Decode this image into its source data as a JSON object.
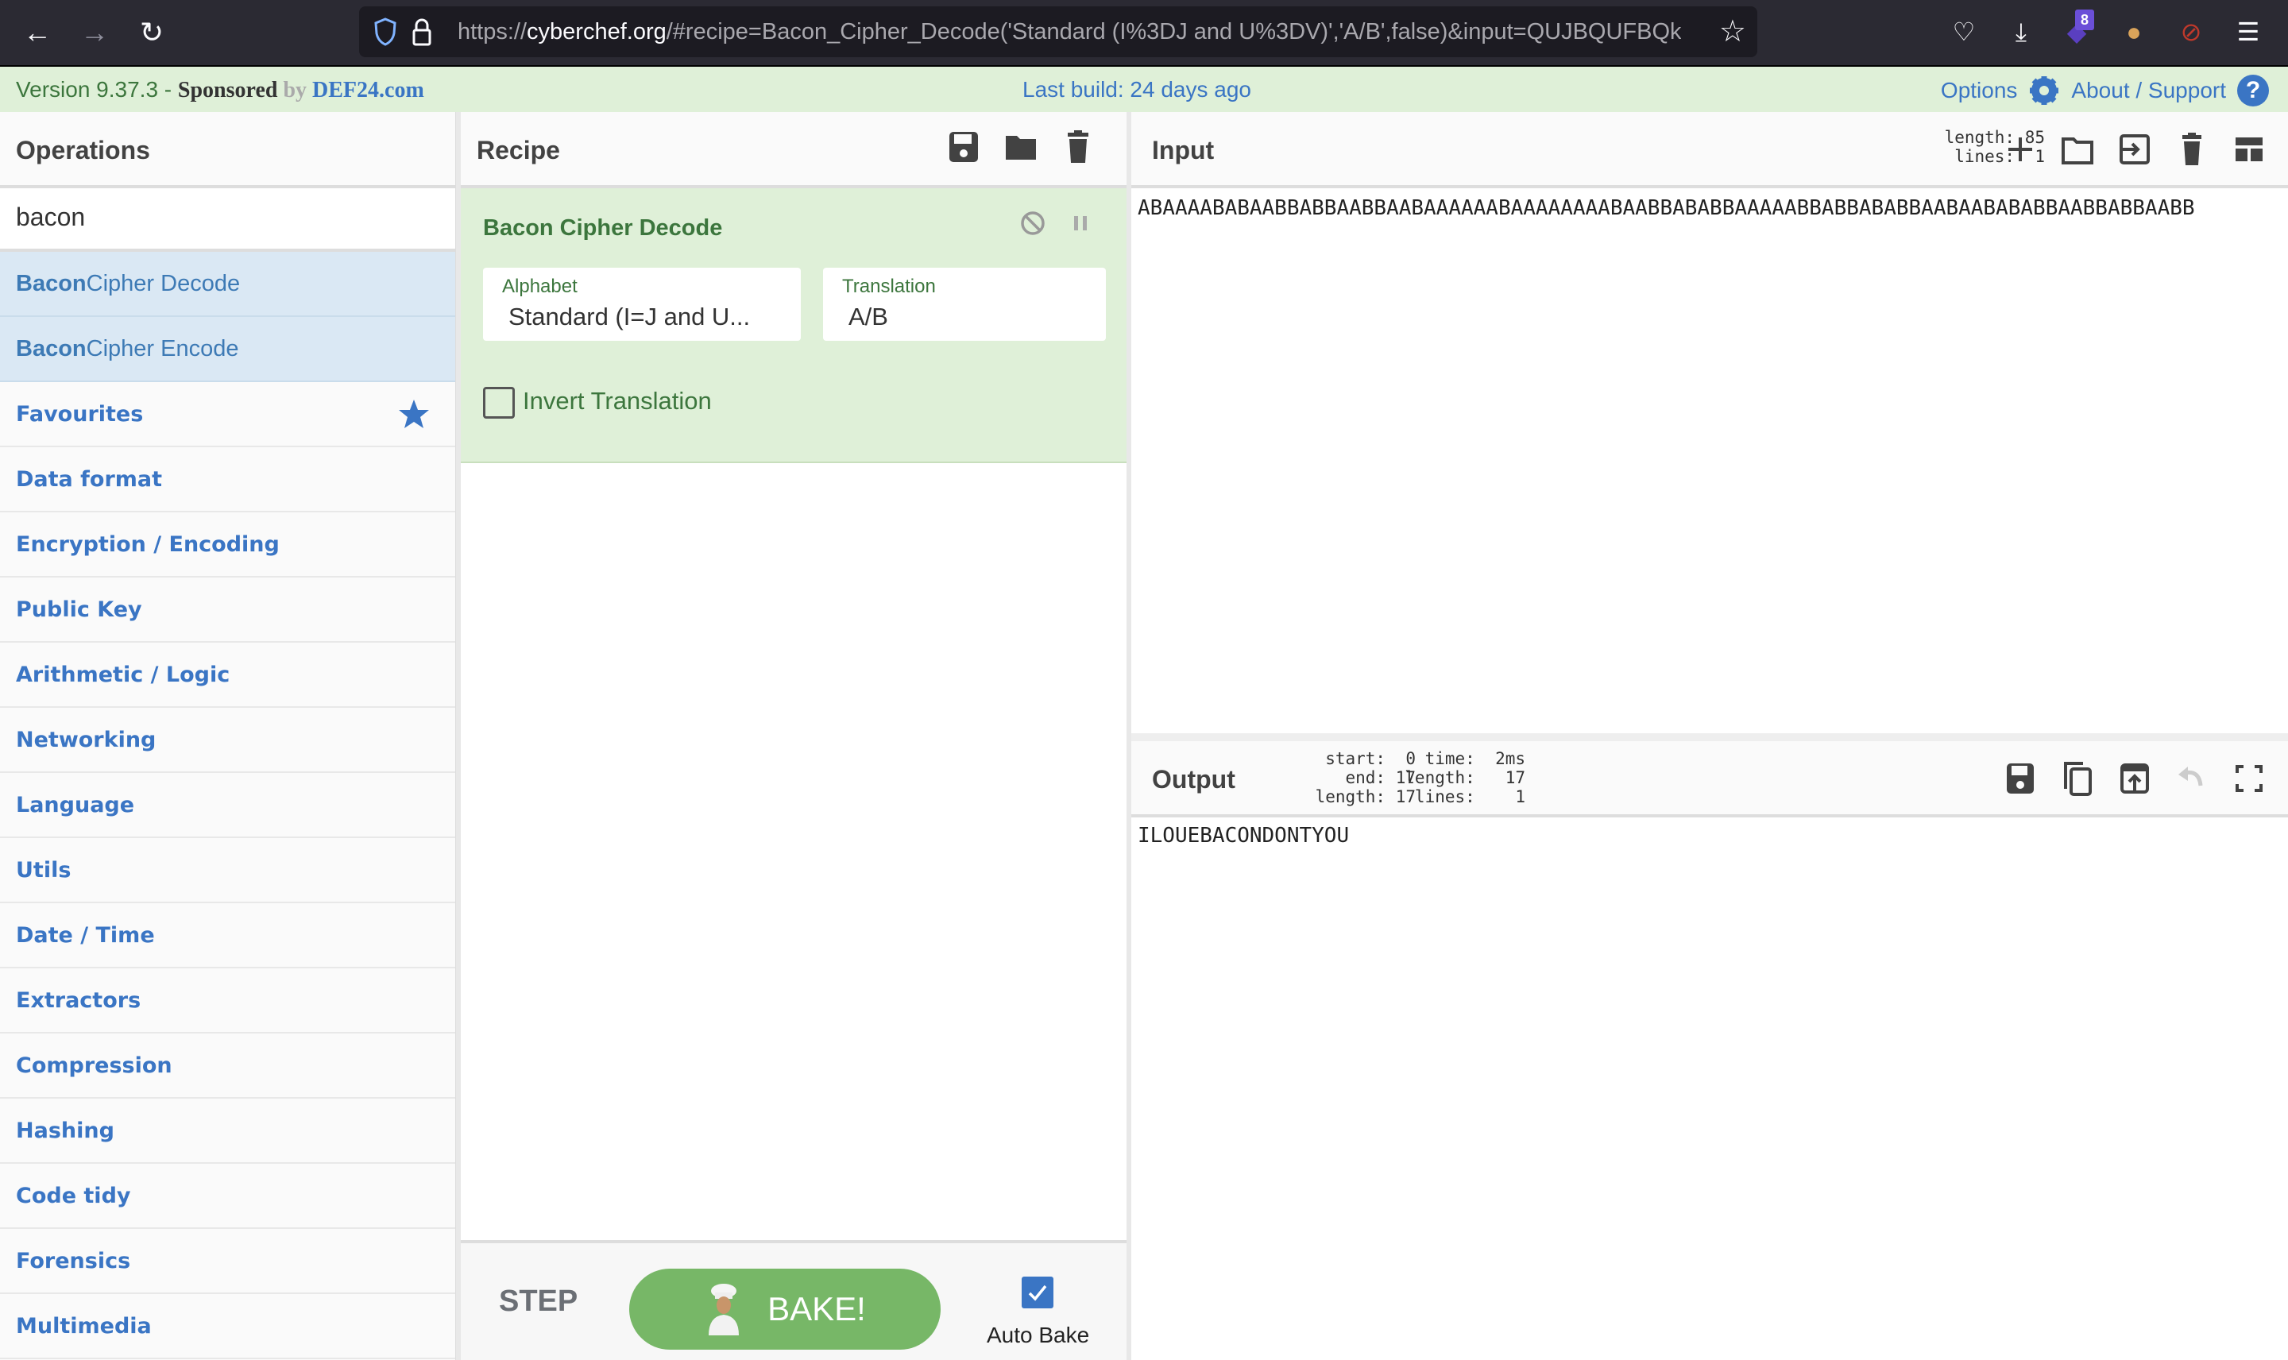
{
  "browser": {
    "url_prefix": "https://",
    "url_host": "cyberchef.org",
    "url_rest": "/#recipe=Bacon_Cipher_Decode('Standard (I%3DJ and U%3DV)','A/B',false)&input=QUJBQUFBQkFC",
    "extension_badge": "8"
  },
  "banner": {
    "version": "Version 9.37.3 - ",
    "sponsored": "Sponsored",
    "by": " by ",
    "sponsor": "DEF24.com",
    "last_build": "Last build: 24 days ago",
    "options": "Options",
    "about": "About / Support",
    "help_glyph": "?"
  },
  "operations": {
    "title": "Operations",
    "search_value": "bacon",
    "results": [
      {
        "match": "Bacon",
        "rest": " Cipher Decode"
      },
      {
        "match": "Bacon",
        "rest": " Cipher Encode"
      }
    ],
    "categories": [
      "Favourites",
      "Data format",
      "Encryption / Encoding",
      "Public Key",
      "Arithmetic / Logic",
      "Networking",
      "Language",
      "Utils",
      "Date / Time",
      "Extractors",
      "Compression",
      "Hashing",
      "Code tidy",
      "Forensics",
      "Multimedia"
    ]
  },
  "recipe": {
    "title": "Recipe",
    "operation": {
      "name": "Bacon Cipher Decode",
      "args": [
        {
          "label": "Alphabet",
          "value": "Standard (I=J and U..."
        },
        {
          "label": "Translation",
          "value": "A/B"
        }
      ],
      "invert_label": "Invert Translation",
      "invert_checked": false
    },
    "step_label": "STEP",
    "bake_label": "BAKE!",
    "auto_bake_label": "Auto Bake",
    "auto_bake_checked": true
  },
  "input": {
    "title": "Input",
    "stats": "length: 85\n lines:  1",
    "text": "ABAAAABABAABBABBAABBAABAAAAAABAAAAAAAABAABBABABBAAAAABBABBABABBAABAABABABBAABBABBAABB"
  },
  "output": {
    "title": "Output",
    "stats_left": " start:  0\n   end: 17\nlength: 17",
    "stats_right": "  time:  2ms\nlength:   17\n lines:    1",
    "text": "ILOUEBACONDONTYOU"
  },
  "colors": {
    "accent_blue": "#3a75c4",
    "recipe_green": "#dff0d8",
    "bake_green": "#77b767",
    "operation_green_text": "#3c763d"
  }
}
